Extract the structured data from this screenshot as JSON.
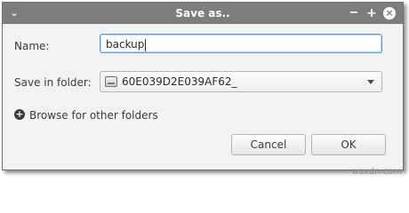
{
  "window": {
    "title": "Save as..",
    "menu_icon": "chevron-down-icon",
    "minimize_label": "−",
    "maximize_label": "+",
    "close_label": "×"
  },
  "form": {
    "name_label": "Name:",
    "name_value": "backup",
    "folder_label": "Save in folder:",
    "folder_value": "60E039D2E039AF62_",
    "folder_icon": "drive-icon",
    "browse_label": "Browse for other folders"
  },
  "buttons": {
    "cancel_label": "Cancel",
    "ok_label": "OK"
  },
  "watermark": "wsxdn.com"
}
